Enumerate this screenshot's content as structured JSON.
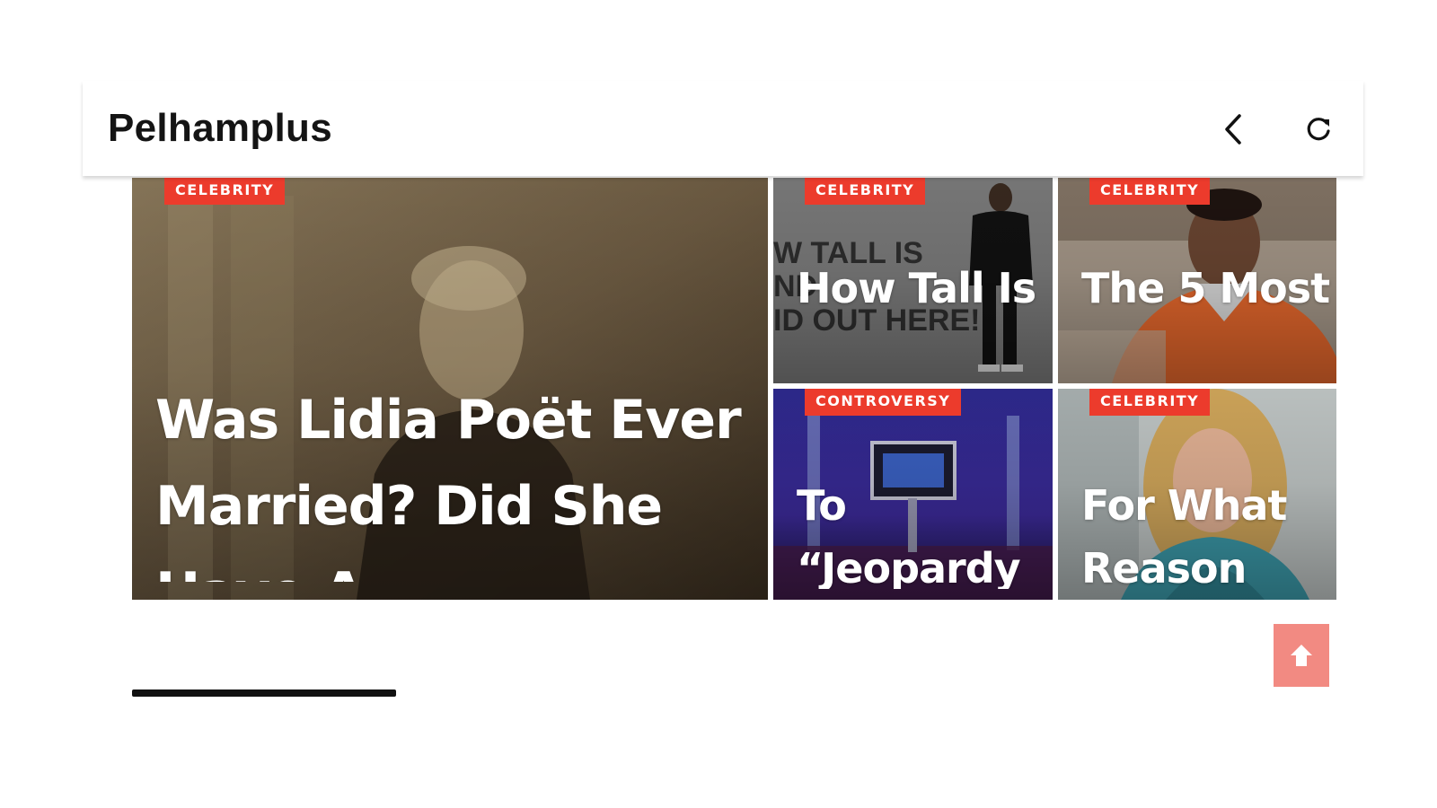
{
  "app": {
    "title": "Pelhamplus"
  },
  "toolbar": {
    "back_icon": "chevron-left-icon",
    "reload_icon": "reload-icon"
  },
  "articles": [
    {
      "category": "CELEBRITY",
      "title": "Was Lidia Poët Ever Married? Did She Have A",
      "image": "sepia portrait of a woman"
    },
    {
      "category": "CELEBRITY",
      "title": "How Tall Is",
      "image": "man standing in black outfit"
    },
    {
      "category": "CELEBRITY",
      "title": "The 5 Most",
      "image": "man in orange jumpsuit"
    },
    {
      "category": "CONTROVERSY",
      "title": "To “Jeopardy",
      "image": "game show stage"
    },
    {
      "category": "CELEBRITY",
      "title": "For What Reason",
      "image": "smiling blonde woman"
    }
  ],
  "scroll_to_top": {
    "icon": "arrow-up-icon"
  },
  "colors": {
    "badge": "#ec3b2c",
    "scroll_to_top_bg": "#f28a82",
    "app_title": "#141414"
  },
  "carousel": {
    "progress": 0.22
  }
}
